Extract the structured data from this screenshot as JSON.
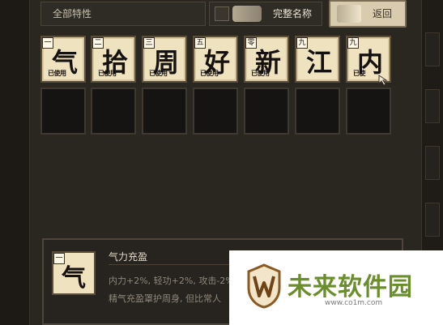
{
  "filter": {
    "value": "全部特性"
  },
  "fullname_toggle": {
    "label": "完整名称"
  },
  "return_button": {
    "label": "返回"
  },
  "cards": [
    {
      "number": "一",
      "char": "气",
      "status": "已使用"
    },
    {
      "number": "二",
      "char": "拾",
      "status": "已使用"
    },
    {
      "number": "三",
      "char": "周",
      "status": "已使用"
    },
    {
      "number": "五",
      "char": "好",
      "status": "已使用"
    },
    {
      "number": "零",
      "char": "新",
      "status": "已使用"
    },
    {
      "number": "九",
      "char": "江",
      "status": ""
    },
    {
      "number": "九",
      "char": "内",
      "status": "已使"
    }
  ],
  "detail": {
    "number": "一",
    "char": "气",
    "name": "气力充盈",
    "line1": "内力+2%, 轻功+2%, 攻击-2%",
    "line2": "精气充盈罩护周身, 但比常人"
  },
  "watermark": {
    "title": "未来软件园",
    "url": "www.co1m.com"
  }
}
